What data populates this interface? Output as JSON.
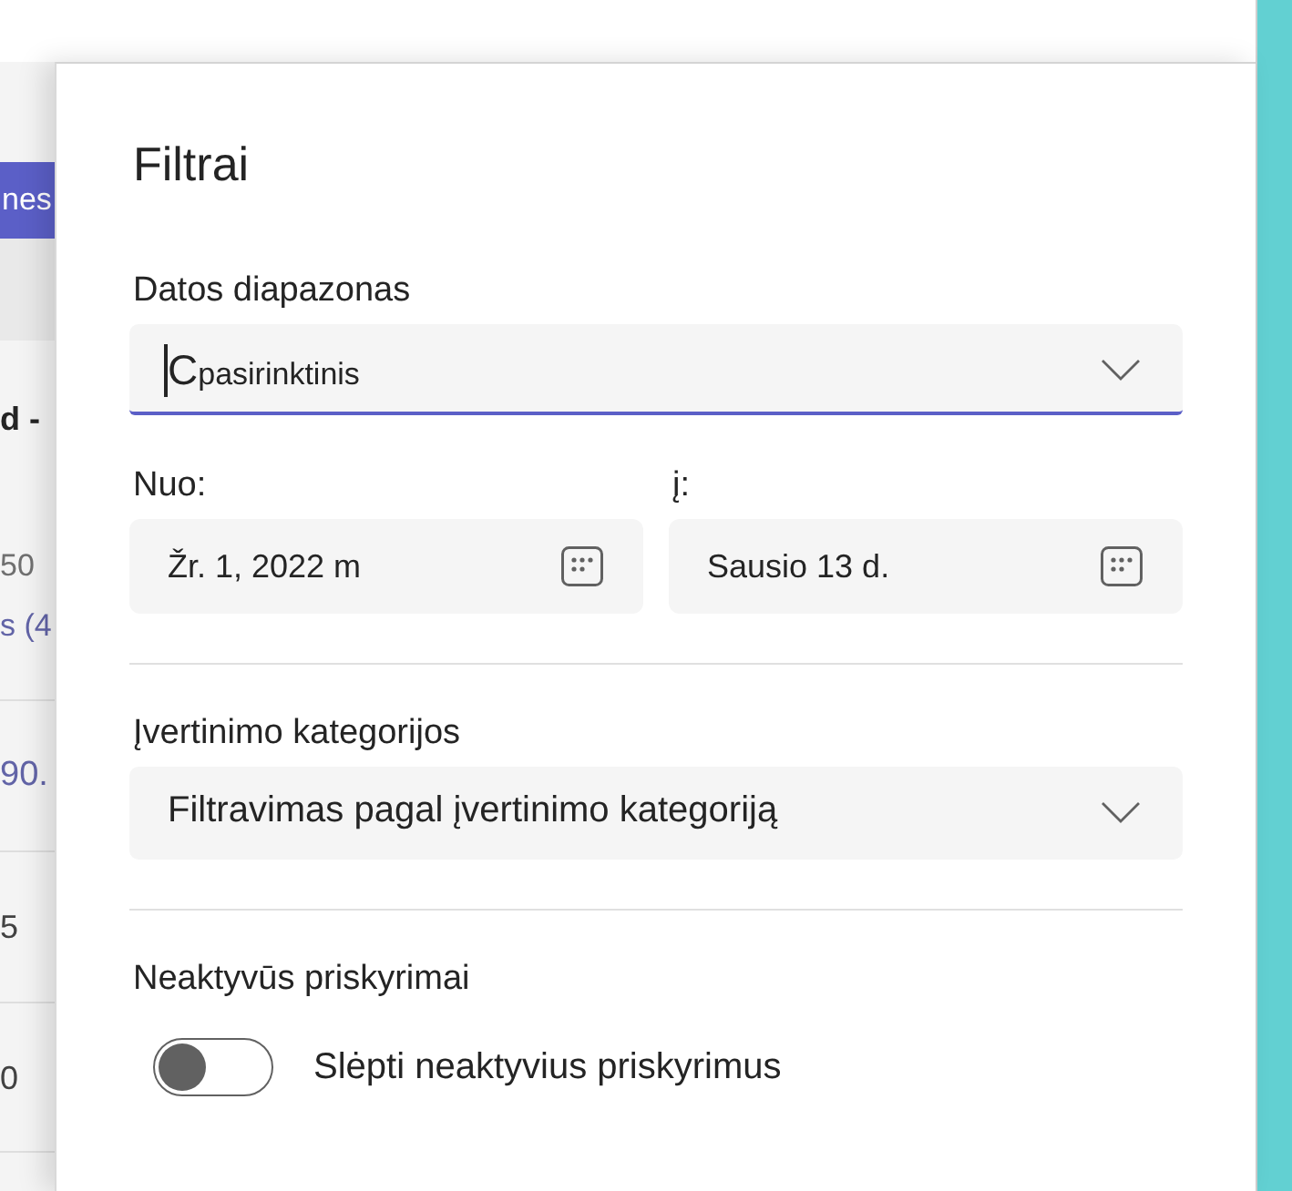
{
  "background_page": {
    "button": "nes",
    "heading": "d -",
    "meta": "50",
    "link": "s (4",
    "rows": [
      {
        "kind": "link",
        "text": "90."
      },
      {
        "kind": "plain",
        "text": "5"
      },
      {
        "kind": "plain",
        "text": "0"
      }
    ]
  },
  "panel": {
    "title": "Filtrai",
    "date_range": {
      "label": "Datos diapazonas",
      "value": "Cpasirinktinis",
      "focused": true
    },
    "from": {
      "label": "Nuo:",
      "value": "Žr. 1, 2022 m"
    },
    "to": {
      "label": "į:",
      "value": "Sausio 13 d."
    },
    "grade_categories": {
      "label": "Įvertinimo kategorijos",
      "placeholder": "Filtravimas pagal įvertinimo kategoriją"
    },
    "inactive": {
      "label": "Neaktyvūs priskyrimai",
      "toggle": {
        "label": "Slėpti neaktyvius priskyrimus",
        "on": false
      }
    }
  }
}
